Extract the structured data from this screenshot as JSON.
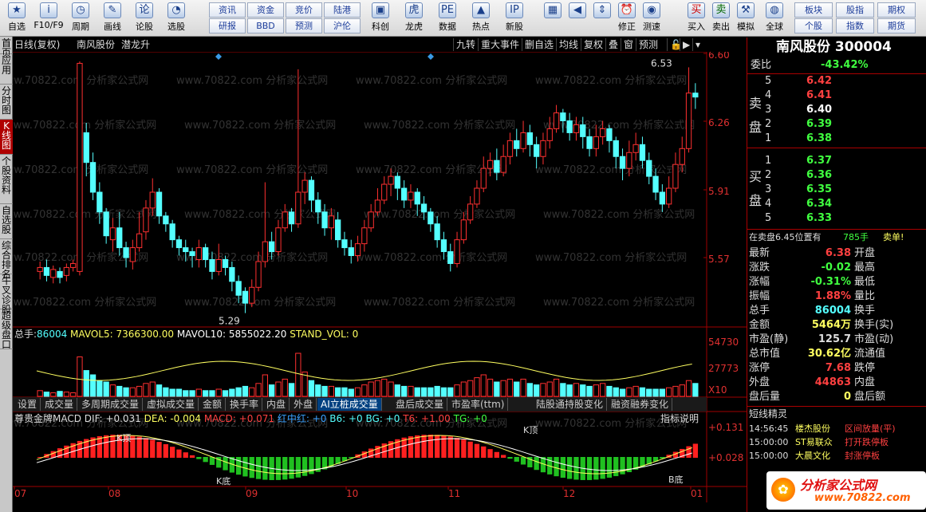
{
  "toolbar": {
    "buttons": [
      {
        "label": "自选",
        "icon": "star-icon"
      },
      {
        "label": "F10/F9",
        "icon": "info-icon"
      },
      {
        "label": "周期",
        "icon": "clock-icon"
      },
      {
        "label": "画线",
        "icon": "pen-icon"
      },
      {
        "label": "论股",
        "icon": "chat-icon"
      },
      {
        "label": "选股",
        "icon": "gauge-icon"
      }
    ],
    "grid": [
      [
        "资讯",
        "资金",
        "竞价",
        "陆港"
      ],
      [
        "研报",
        "BBD",
        "预测",
        "沪伦"
      ]
    ],
    "buttons2": [
      {
        "label": "科创",
        "icon": "chip-icon"
      },
      {
        "label": "龙虎",
        "icon": "tiger-icon"
      },
      {
        "label": "数据",
        "icon": "pe-icon"
      },
      {
        "label": "热点",
        "icon": "hot-icon"
      },
      {
        "label": "新股",
        "icon": "ipo-icon"
      }
    ],
    "nav": [
      {
        "label": "",
        "icon": "grid-icon"
      },
      {
        "label": "",
        "icon": "back-arrow-icon"
      },
      {
        "label": "",
        "icon": "updown-arrow-icon"
      },
      {
        "label": "修正",
        "icon": "alarm-icon"
      },
      {
        "label": "测速",
        "icon": "speed-icon"
      }
    ],
    "trade": [
      {
        "label": "买入",
        "glyph": "买"
      },
      {
        "label": "卖出",
        "glyph": "卖"
      },
      {
        "label": "模拟",
        "icon": "hammer-icon"
      }
    ],
    "right_first": {
      "label": "全球",
      "icon": "globe-icon"
    },
    "right": [
      [
        "板块",
        "股指",
        "期权"
      ],
      [
        "个股",
        "指数",
        "期货"
      ]
    ]
  },
  "sidebar": [
    "首页",
    "应用",
    "分时图",
    "K线图",
    "个股资料",
    "自选股",
    "综合排名",
    "牛叉诊股",
    "超级盘口"
  ],
  "chart_header": {
    "mode": "日线(复权)",
    "stock": "南风股份",
    "tag": "潜龙升",
    "buttons": [
      "九转",
      "重大事件",
      "删自选",
      "均线",
      "复权",
      "叠",
      "窗",
      "预测"
    ]
  },
  "price_axis": [
    "6.60",
    "6.26",
    "5.91",
    "5.57"
  ],
  "annotations": {
    "high": "6.53",
    "low": "5.29"
  },
  "watermark": "www.70822.com 分析家公式网",
  "volume": {
    "label": "总手:",
    "value": "86004",
    "mavol5": "MAVOL5: 7366300.00",
    "mavol10": "MAVOL10: 5855022.20",
    "stand": "STAND_VOL: 0",
    "axis": [
      "54730",
      "27773"
    ],
    "unit": "X10"
  },
  "indicator_tabs": [
    "设置",
    "成交量",
    "多周期成交量",
    "虚拟成交量",
    "金额",
    "换手率",
    "内盘",
    "外盘",
    "AI立桩成交量",
    "盘后成交量",
    "市盈率(ttm)",
    "陆股通持股变化",
    "融资融券变化"
  ],
  "macd": {
    "title": "尊贵金牌MACD",
    "items": [
      "DIF: +0.031",
      "DEA: -0.004",
      "MACD: +0.071",
      "红中红: +0",
      "B6: +0",
      "BG: +0",
      "T6: +1.00",
      "TG: +0"
    ],
    "button": "指标说明",
    "axis": [
      "+0.131",
      "+0.028"
    ],
    "labels": [
      "K顶",
      "K顶",
      "K底",
      "B底"
    ]
  },
  "months": [
    "07",
    "08",
    "09",
    "10",
    "11",
    "12",
    "01"
  ],
  "quote": {
    "title": "南风股份 300004",
    "weibi": {
      "label": "委比",
      "value": "-43.42%"
    },
    "sell_label": "卖盘",
    "buy_label": "买盘",
    "asks": [
      {
        "n": "5",
        "p": "6.42"
      },
      {
        "n": "4",
        "p": "6.41"
      },
      {
        "n": "3",
        "p": "6.40"
      },
      {
        "n": "2",
        "p": "6.39"
      },
      {
        "n": "1",
        "p": "6.38"
      }
    ],
    "bids": [
      {
        "n": "1",
        "p": "6.37"
      },
      {
        "n": "2",
        "p": "6.36"
      },
      {
        "n": "3",
        "p": "6.35"
      },
      {
        "n": "4",
        "p": "6.34"
      },
      {
        "n": "5",
        "p": "6.33"
      }
    ],
    "notice": {
      "text": "在卖盘6.45位置有",
      "qty": "785手",
      "act": "卖单!"
    },
    "stats": [
      {
        "l": "最新",
        "v": "6.38",
        "r": "开盘"
      },
      {
        "l": "涨跌",
        "v": "-0.02",
        "r": "最高"
      },
      {
        "l": "涨幅",
        "v": "-0.31%",
        "r": "最低"
      },
      {
        "l": "振幅",
        "v": "1.88%",
        "r": "量比"
      },
      {
        "l": "总手",
        "v": "86004",
        "r": "换手"
      },
      {
        "l": "金额",
        "v": "5464万",
        "r": "换手(实)"
      },
      {
        "l": "市盈(静)",
        "v": "125.7",
        "r": "市盈(动)"
      },
      {
        "l": "总市值",
        "v": "30.62亿",
        "r": "流通值"
      },
      {
        "l": "涨停",
        "v": "7.68",
        "r": "跌停"
      },
      {
        "l": "外盘",
        "v": "44863",
        "r": "内盘"
      },
      {
        "l": "盘后量",
        "v": "0",
        "r": "盘后额"
      }
    ],
    "news_title": "短线精灵",
    "news": [
      {
        "t": "14:56:45",
        "n": "楼杰股份",
        "e": "区间放量(平)"
      },
      {
        "t": "15:00:00",
        "n": "ST易联众",
        "e": "打开跌停板"
      },
      {
        "t": "15:00:00",
        "n": "大晨文化",
        "e": "封涨停板"
      }
    ],
    "logo": "分析家公式网",
    "logo_url": "www.70822.com"
  }
}
